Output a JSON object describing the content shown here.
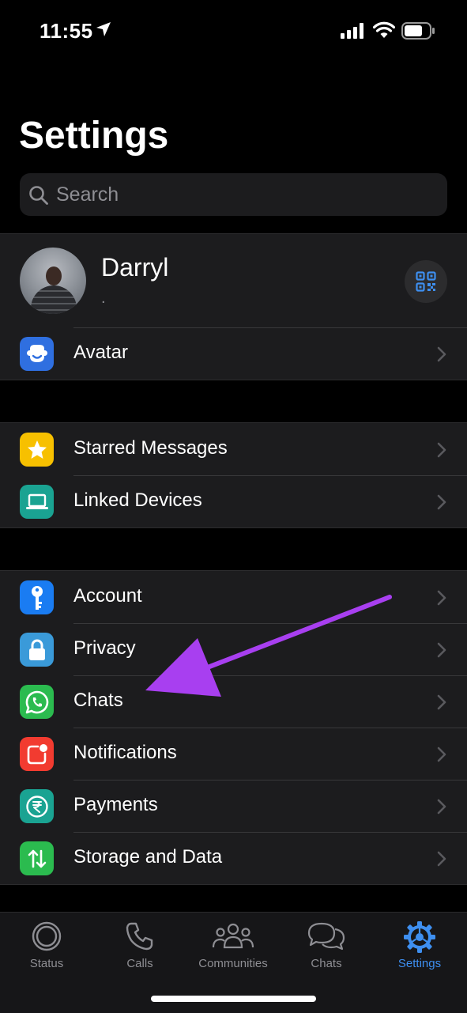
{
  "status_bar": {
    "time": "11:55"
  },
  "header": {
    "title": "Settings"
  },
  "search": {
    "placeholder": "Search"
  },
  "profile": {
    "name": "Darryl",
    "status": "."
  },
  "group_avatar": [
    {
      "label": "Avatar",
      "color": "#2f6fe0",
      "icon": "avatar-face-icon"
    }
  ],
  "group_tools": [
    {
      "label": "Starred Messages",
      "color": "#f7c000",
      "icon": "star-icon"
    },
    {
      "label": "Linked Devices",
      "color": "#1aa392",
      "icon": "laptop-icon"
    }
  ],
  "group_settings": [
    {
      "label": "Account",
      "color": "#1a7cf2",
      "icon": "key-icon"
    },
    {
      "label": "Privacy",
      "color": "#3a9ad9",
      "icon": "lock-icon"
    },
    {
      "label": "Chats",
      "color": "#2bbb4f",
      "icon": "whatsapp-icon"
    },
    {
      "label": "Notifications",
      "color": "#f23b30",
      "icon": "notification-badge-icon"
    },
    {
      "label": "Payments",
      "color": "#1aa392",
      "icon": "rupee-icon"
    },
    {
      "label": "Storage and Data",
      "color": "#2bbb4f",
      "icon": "up-down-arrows-icon"
    }
  ],
  "tabs": [
    {
      "label": "Status",
      "icon": "status-ring-icon",
      "active": false
    },
    {
      "label": "Calls",
      "icon": "phone-icon",
      "active": false
    },
    {
      "label": "Communities",
      "icon": "people-icon",
      "active": false
    },
    {
      "label": "Chats",
      "icon": "chat-bubbles-icon",
      "active": false
    },
    {
      "label": "Settings",
      "icon": "gear-icon",
      "active": true
    }
  ],
  "colors": {
    "accent": "#3e8ff0",
    "annotation_arrow": "#a83ff0"
  }
}
